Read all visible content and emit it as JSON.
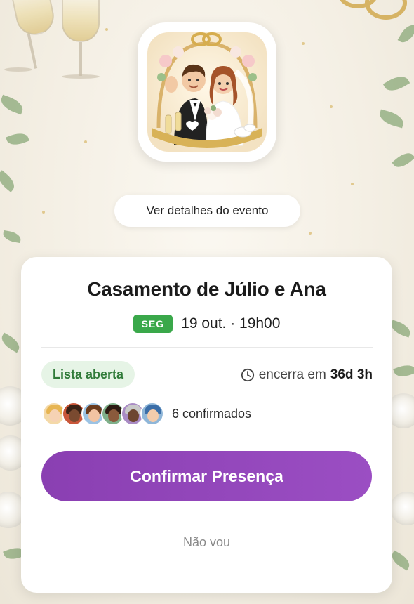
{
  "details_button": {
    "label": "Ver detalhes do evento"
  },
  "event": {
    "title": "Casamento de Júlio e Ana",
    "day_badge": "SEG",
    "date": "19 out. · 19h00"
  },
  "status": {
    "badge": "Lista aberta",
    "deadline_prefix": "encerra em",
    "deadline_value": "36d 3h"
  },
  "attendees": {
    "confirmed_label": "6 confirmados",
    "avatars": [
      "avatar-1",
      "avatar-2",
      "avatar-3",
      "avatar-4",
      "avatar-5",
      "avatar-6"
    ]
  },
  "actions": {
    "confirm_label": "Confirmar Presença",
    "decline_label": "Não vou"
  },
  "colors": {
    "accent": "#9247bc",
    "day_badge": "#3aa84a",
    "status_bg": "#e6f4e6",
    "status_text": "#2f7a38"
  },
  "icons": [
    "clock-icon",
    "event-app-icon"
  ]
}
